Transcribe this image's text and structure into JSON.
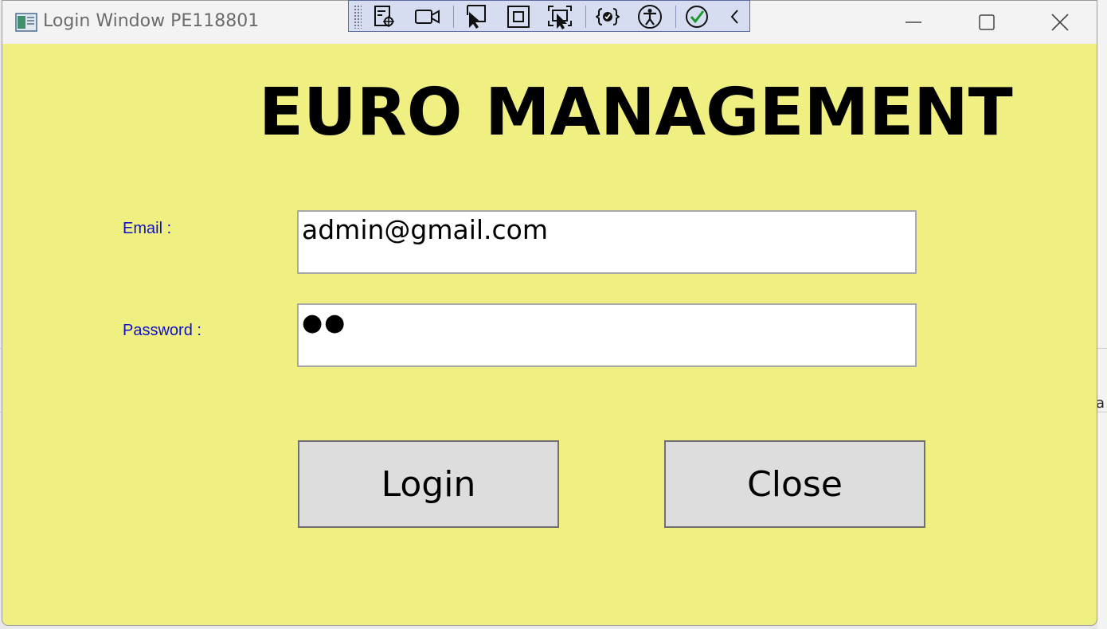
{
  "window": {
    "title": "Login Window PE118801"
  },
  "devtools": {
    "icons": [
      "live-visual-tree-icon",
      "record-icon",
      "select-element-icon",
      "adorner-icon",
      "track-focus-icon",
      "binding-failures-icon",
      "accessibility-icon",
      "checkmark-icon",
      "collapse-chevron-icon"
    ]
  },
  "main": {
    "heading": "EURO MANAGEMENT",
    "email_label": "Email :",
    "email_value": "admin@gmail.com",
    "password_label": "Password :",
    "password_value": "●●",
    "login_label": "Login",
    "close_label": "Close"
  },
  "background": {
    "edge_text": "a"
  },
  "colors": {
    "window_bg": "#f0ef82",
    "label_color": "#1010c8",
    "button_bg": "#dddddd",
    "devbar_bg": "#d7ddf0"
  }
}
